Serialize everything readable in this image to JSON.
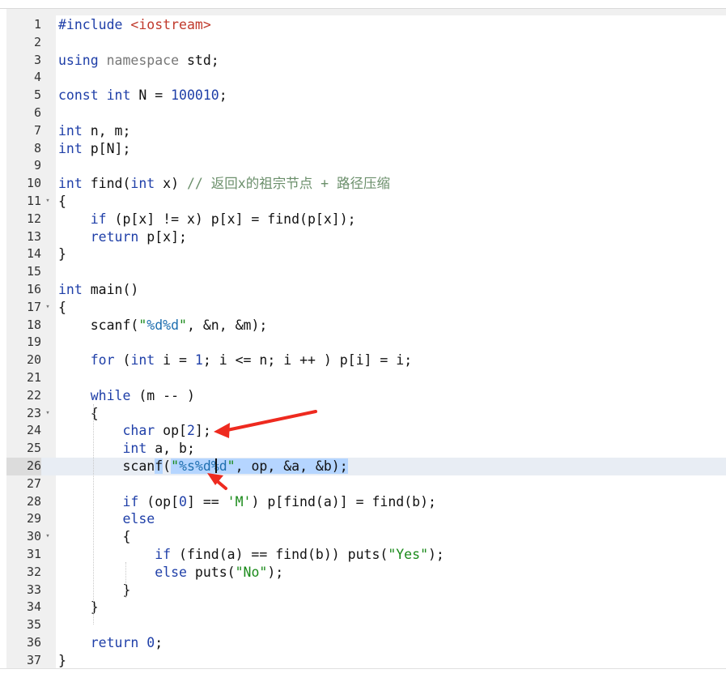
{
  "editor": {
    "active_line": 26,
    "lines": [
      {
        "n": "1",
        "text": "#include <iostream>",
        "fold": ""
      },
      {
        "n": "2",
        "text": "",
        "fold": ""
      },
      {
        "n": "3",
        "text": "using namespace std;",
        "fold": ""
      },
      {
        "n": "4",
        "text": "",
        "fold": ""
      },
      {
        "n": "5",
        "text": "const int N = 100010;",
        "fold": ""
      },
      {
        "n": "6",
        "text": "",
        "fold": ""
      },
      {
        "n": "7",
        "text": "int n, m;",
        "fold": ""
      },
      {
        "n": "8",
        "text": "int p[N];",
        "fold": ""
      },
      {
        "n": "9",
        "text": "",
        "fold": ""
      },
      {
        "n": "10",
        "text": "int find(int x) // 返回x的祖宗节点 + 路径压缩",
        "fold": ""
      },
      {
        "n": "11",
        "text": "{",
        "fold": "▾"
      },
      {
        "n": "12",
        "text": "    if (p[x] != x) p[x] = find(p[x]);",
        "fold": ""
      },
      {
        "n": "13",
        "text": "    return p[x];",
        "fold": ""
      },
      {
        "n": "14",
        "text": "}",
        "fold": ""
      },
      {
        "n": "15",
        "text": "",
        "fold": ""
      },
      {
        "n": "16",
        "text": "int main()",
        "fold": ""
      },
      {
        "n": "17",
        "text": "{",
        "fold": "▾"
      },
      {
        "n": "18",
        "text": "    scanf(\"%d%d\", &n, &m);",
        "fold": ""
      },
      {
        "n": "19",
        "text": "",
        "fold": ""
      },
      {
        "n": "20",
        "text": "    for (int i = 1; i <= n; i ++ ) p[i] = i;",
        "fold": ""
      },
      {
        "n": "21",
        "text": "",
        "fold": ""
      },
      {
        "n": "22",
        "text": "    while (m -- )",
        "fold": ""
      },
      {
        "n": "23",
        "text": "    {",
        "fold": "▾"
      },
      {
        "n": "24",
        "text": "        char op[2];",
        "fold": ""
      },
      {
        "n": "25",
        "text": "        int a, b;",
        "fold": ""
      },
      {
        "n": "26",
        "text": "        scanf(\"%s%d%d\", op, &a, &b);",
        "fold": ""
      },
      {
        "n": "27",
        "text": "",
        "fold": ""
      },
      {
        "n": "28",
        "text": "        if (op[0] == 'M') p[find(a)] = find(b);",
        "fold": ""
      },
      {
        "n": "29",
        "text": "        else",
        "fold": ""
      },
      {
        "n": "30",
        "text": "        {",
        "fold": "▾"
      },
      {
        "n": "31",
        "text": "            if (find(a) == find(b)) puts(\"Yes\");",
        "fold": ""
      },
      {
        "n": "32",
        "text": "            else puts(\"No\");",
        "fold": ""
      },
      {
        "n": "33",
        "text": "        }",
        "fold": ""
      },
      {
        "n": "34",
        "text": "    }",
        "fold": ""
      },
      {
        "n": "35",
        "text": "",
        "fold": ""
      },
      {
        "n": "36",
        "text": "    return 0;",
        "fold": ""
      },
      {
        "n": "37",
        "text": "}",
        "fold": ""
      }
    ]
  },
  "annotations": {
    "arrow_color": "#ee2a1f",
    "selection_color": "#b5d5ff"
  }
}
